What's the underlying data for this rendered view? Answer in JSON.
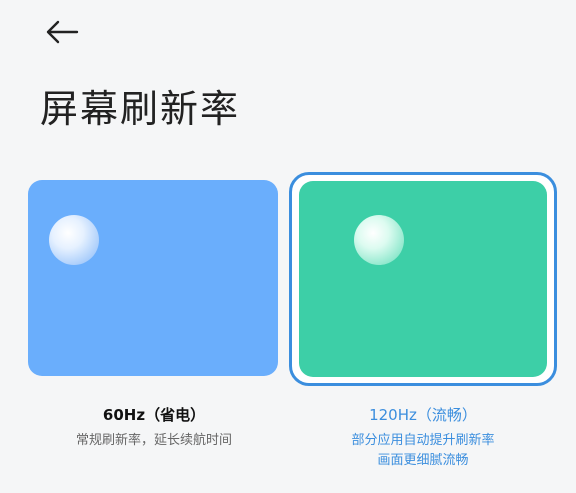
{
  "header": {
    "back_icon": "arrow-left-icon",
    "title": "屏幕刷新率"
  },
  "options": [
    {
      "id": "60hz",
      "title": "60Hz（省电）",
      "desc_lines": [
        "常规刷新率，延长续航时间"
      ],
      "selected": false,
      "card_color": "#6aaefc"
    },
    {
      "id": "120hz",
      "title": "120Hz（流畅）",
      "desc_lines": [
        "部分应用自动提升刷新率",
        "画面更细腻流畅"
      ],
      "selected": true,
      "card_color": "#3dcfa7",
      "accent_color": "#3b8ede"
    }
  ]
}
